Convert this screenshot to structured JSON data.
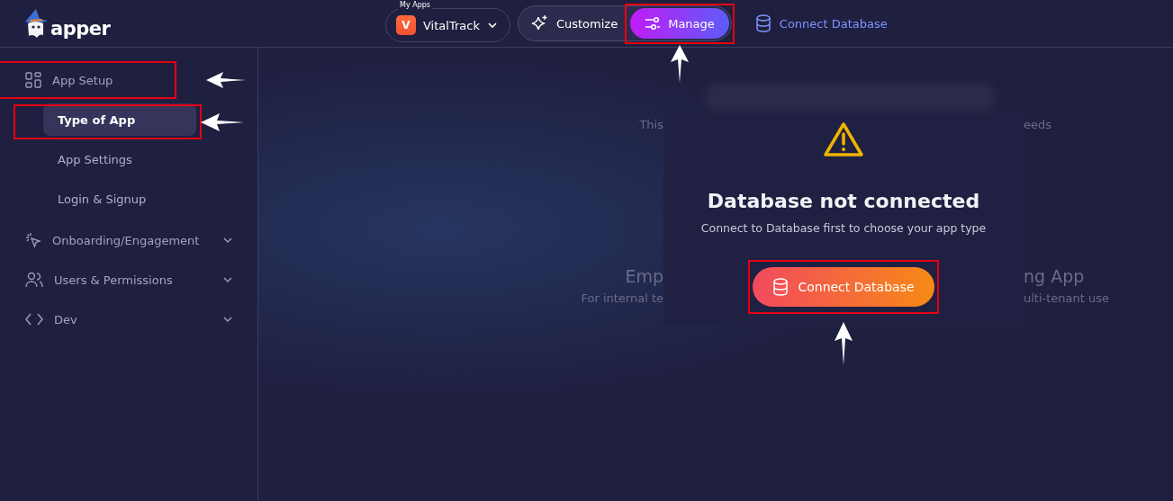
{
  "header": {
    "logo_text": "apper",
    "app_picker": {
      "caption": "My Apps",
      "initial": "V",
      "name": "VitalTrack"
    },
    "mode_tabs": [
      {
        "label": "Customize",
        "selected": false
      },
      {
        "label": "Manage",
        "selected": true
      }
    ],
    "connect_link": "Connect Database"
  },
  "sidebar": {
    "items": [
      {
        "label": "App Setup",
        "expanded": true,
        "children": [
          {
            "label": "Type of App",
            "selected": true
          },
          {
            "label": "App Settings",
            "selected": false
          },
          {
            "label": "Login & Signup",
            "selected": false
          }
        ]
      },
      {
        "label": "Onboarding/Engagement",
        "expanded": false
      },
      {
        "label": "Users & Permissions",
        "expanded": false
      },
      {
        "label": "Dev",
        "expanded": false
      }
    ]
  },
  "background": {
    "left": [
      "This",
      "Emp",
      "For internal te"
    ],
    "right": [
      "eeds",
      "ng App",
      "ulti-tenant use"
    ]
  },
  "dialog": {
    "title": "Database not connected",
    "message": "Connect to Database first to choose your app type",
    "button": "Connect Database"
  }
}
